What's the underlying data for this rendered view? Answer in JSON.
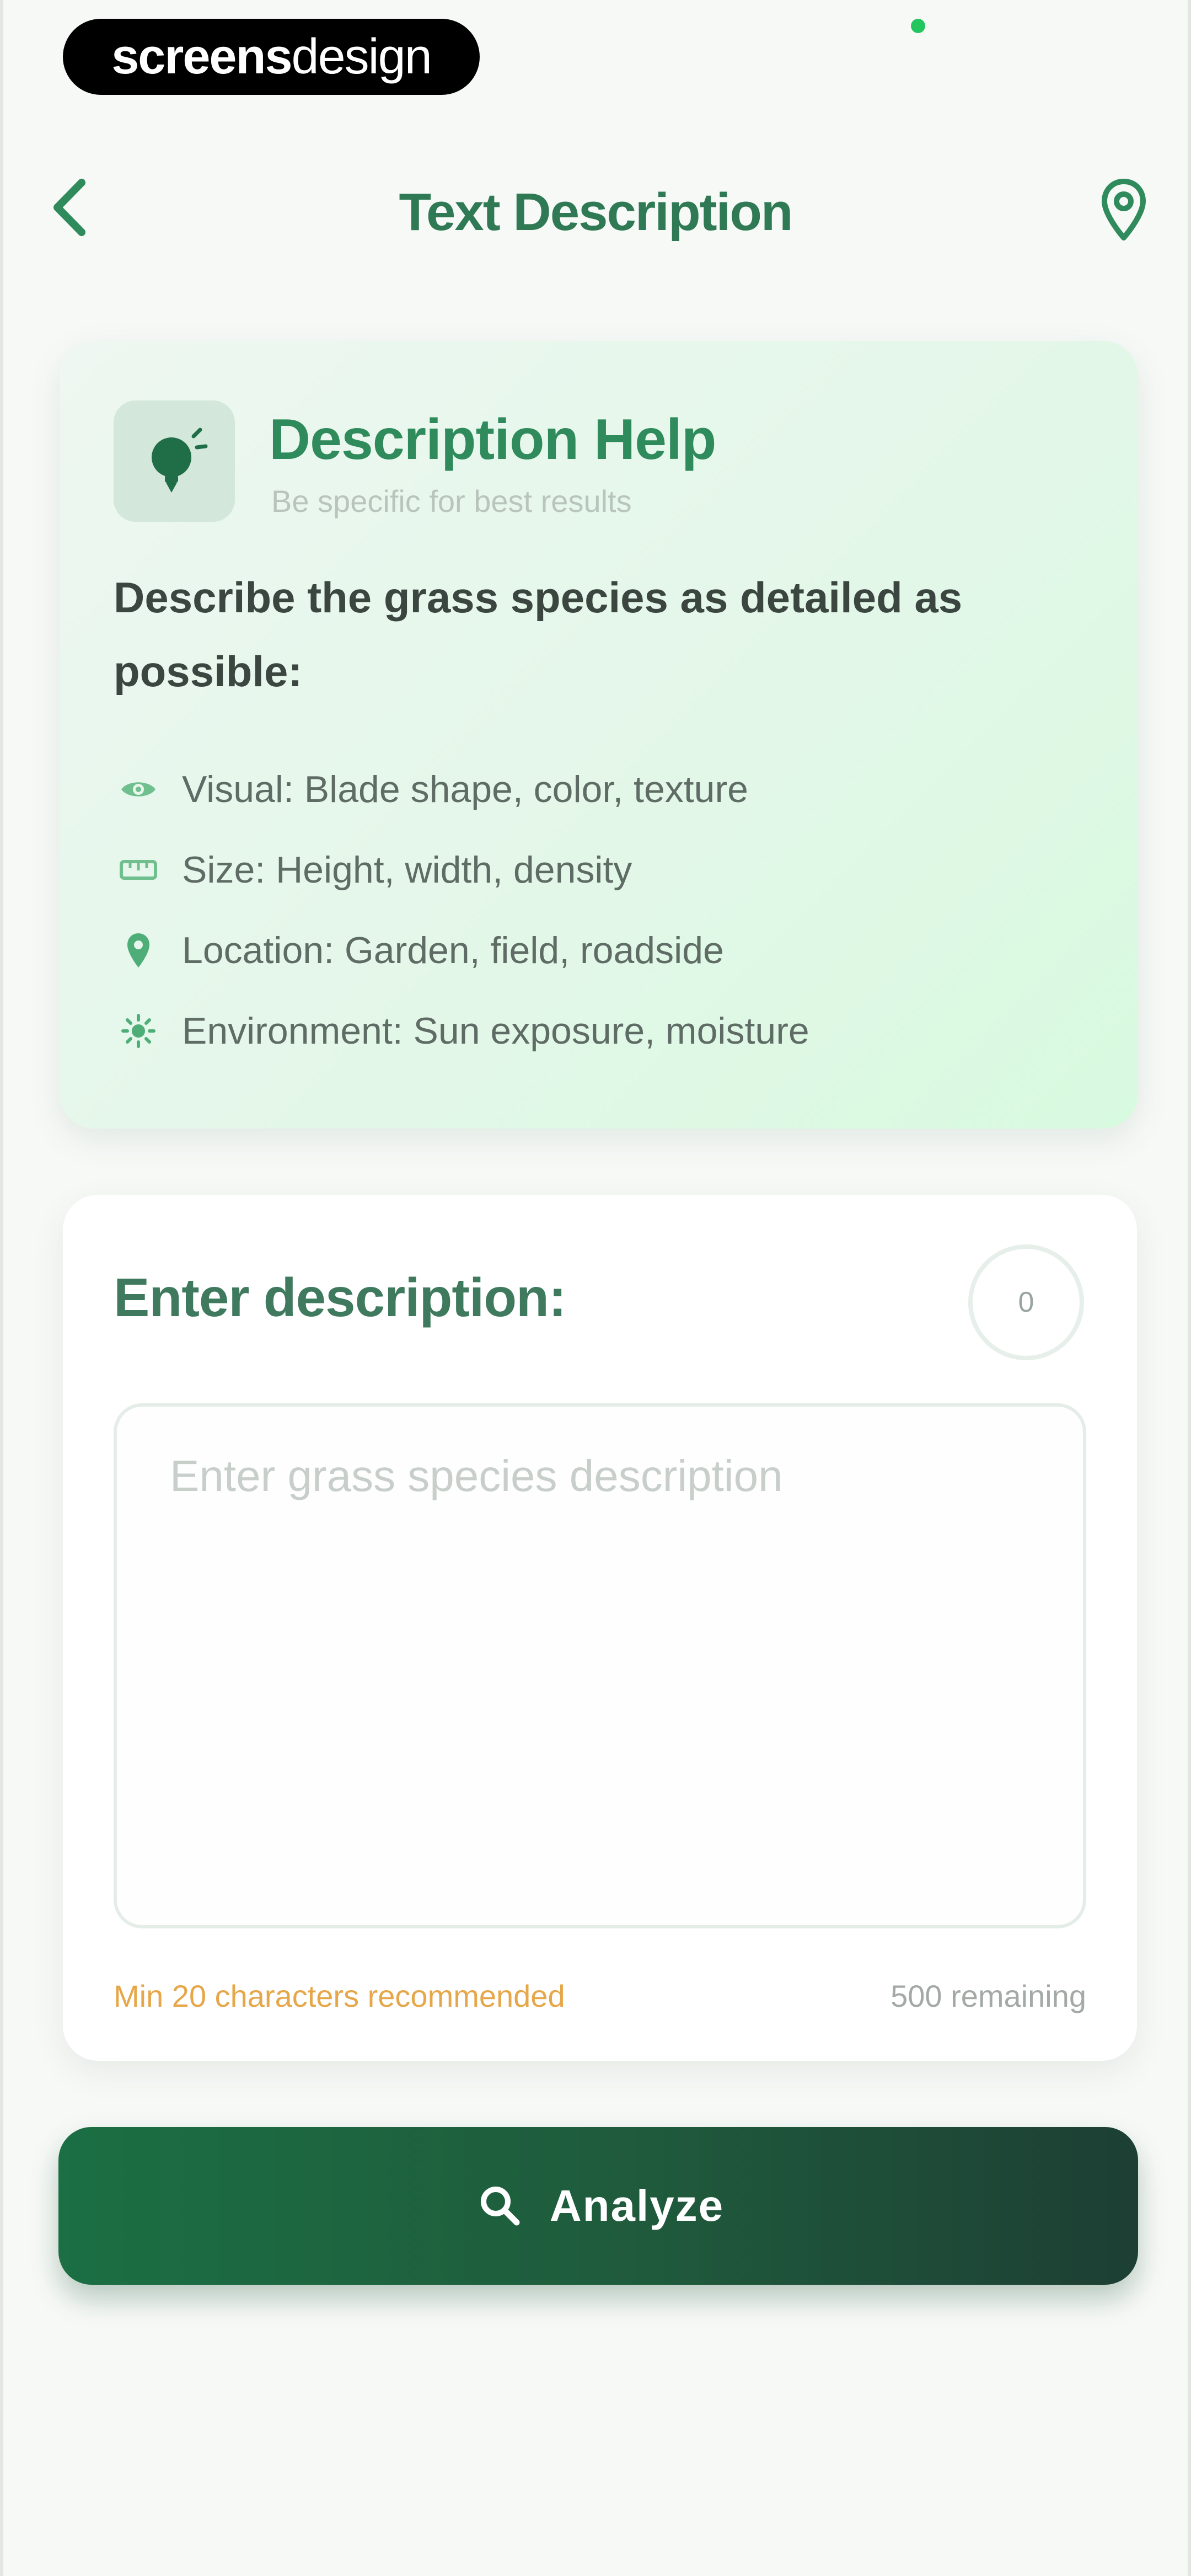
{
  "watermark": {
    "bold": "screens",
    "light": "design"
  },
  "header": {
    "title": "Text Description",
    "back_icon": "chevron-left-icon",
    "location_icon": "map-pin-icon"
  },
  "help_card": {
    "icon": "lightbulb-icon",
    "title": "Description Help",
    "subtitle": "Be specific for best results",
    "instructions": "Describe the grass species as detailed as possible:",
    "items": [
      {
        "icon": "eye-icon",
        "label": "Visual: Blade shape, color, texture"
      },
      {
        "icon": "ruler-icon",
        "label": "Size: Height, width, density"
      },
      {
        "icon": "map-pin-icon",
        "label": "Location: Garden, field, roadside"
      },
      {
        "icon": "sun-icon",
        "label": "Environment: Sun exposure, moisture"
      }
    ]
  },
  "description": {
    "label": "Enter description:",
    "char_count": "0",
    "value": "",
    "placeholder": "Enter grass species description",
    "min_hint": "Min 20 characters recommended",
    "remaining": "500 remaining"
  },
  "analyze_button": {
    "icon": "search-icon",
    "label": "Analyze"
  },
  "colors": {
    "primary_green": "#2f8a5c",
    "button_dark": "#1d3f34",
    "warning_orange": "#e6a74a",
    "card_tint": "#e2f7e8"
  }
}
